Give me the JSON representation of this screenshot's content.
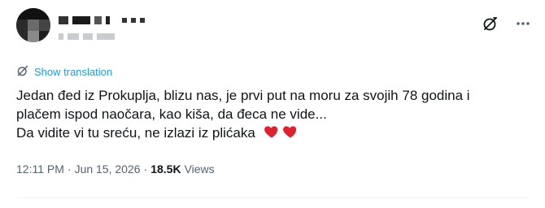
{
  "tweet": {
    "translate_label": "Show translation",
    "lines": [
      "Jedan đed iz Prokuplja, blizu nas, je prvi put na moru za svojih 78 godina i",
      "plačem ispod naočara, kao kiša, da đeca ne vide...",
      "Da vidite vi tu sreću, ne izlazi iz plićaka"
    ],
    "emoji": "❤️❤️"
  },
  "meta": {
    "time": "12:11 PM",
    "separator": "·",
    "date": "Jun 15, 2026",
    "views_count": "18.5K",
    "views_label": "Views"
  },
  "icons": {
    "grok": "grok-icon",
    "more": "more-icon",
    "translate": "translate-icon"
  },
  "colors": {
    "link": "#1d9bf0",
    "text": "#0f1419",
    "muted": "#536471",
    "heart": "#f4212e"
  }
}
